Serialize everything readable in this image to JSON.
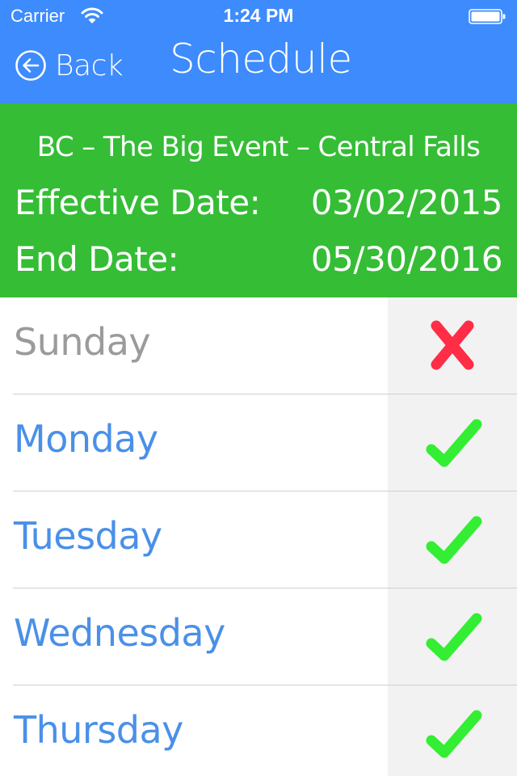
{
  "status_bar": {
    "carrier": "Carrier",
    "time": "1:24 PM",
    "wifi_icon": "wifi-icon",
    "battery_icon": "battery-full-icon"
  },
  "navbar": {
    "back_label": "Back",
    "back_icon": "arrow-left-circle-icon",
    "title": "Schedule"
  },
  "info": {
    "event_name": "BC – The Big Event – Central Falls",
    "effective_date_label": "Effective Date:",
    "effective_date": "03/02/2015",
    "end_date_label": "End Date:",
    "end_date": "05/30/2016"
  },
  "days": [
    {
      "name": "Sunday",
      "active": false,
      "status_icon": "x-icon"
    },
    {
      "name": "Monday",
      "active": true,
      "status_icon": "checkmark-icon"
    },
    {
      "name": "Tuesday",
      "active": true,
      "status_icon": "checkmark-icon"
    },
    {
      "name": "Wednesday",
      "active": true,
      "status_icon": "checkmark-icon"
    },
    {
      "name": "Thursday",
      "active": true,
      "status_icon": "checkmark-icon"
    }
  ],
  "colors": {
    "navbar": "#3d8bfd",
    "info_bg": "#35bd35",
    "active_day": "#4a90e8",
    "inactive_day": "#9b9b9b",
    "check": "#33ee33",
    "cross": "#ff2d46",
    "status_column": "#f2f2f2"
  }
}
